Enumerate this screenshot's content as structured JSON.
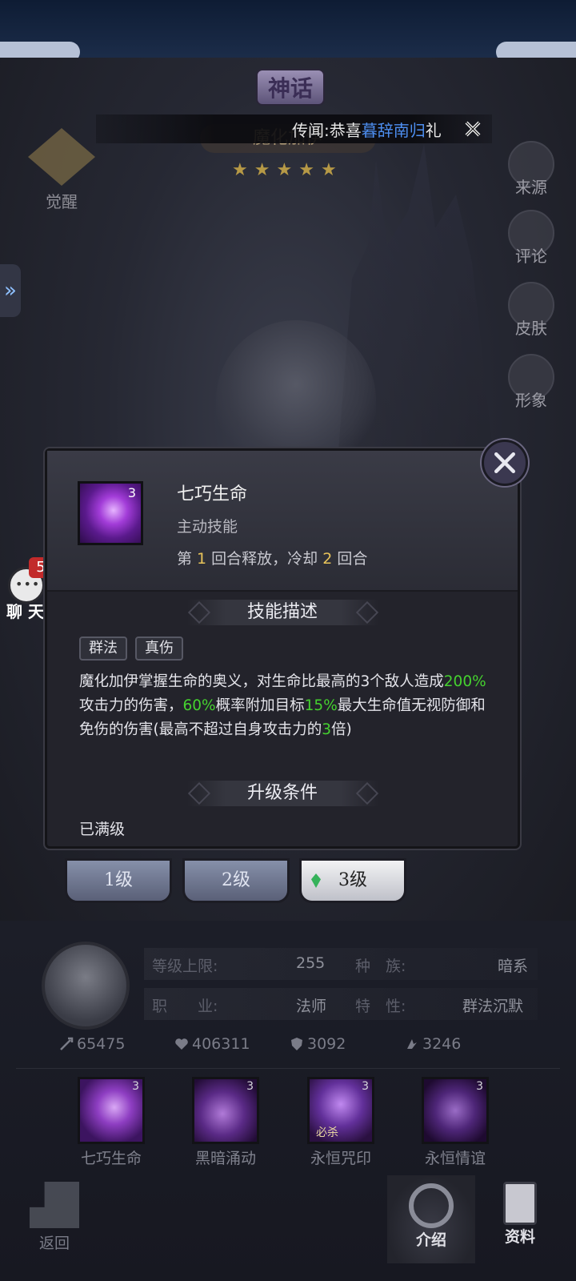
{
  "news": {
    "label": "传闻:",
    "body": "恭喜",
    "name": "暮辞南归",
    "tail": "礼"
  },
  "hero": {
    "rank": "神话",
    "name": "魔化加伊",
    "stars": [
      "★",
      "★",
      "★",
      "★",
      "★"
    ]
  },
  "awaken": {
    "label": "觉醒"
  },
  "side_buttons": [
    {
      "label": "来源"
    },
    {
      "label": "评论"
    },
    {
      "label": "皮肤"
    },
    {
      "label": "形象"
    }
  ],
  "left_tab": {
    "glyph": "»"
  },
  "chat": {
    "badge": "5",
    "label": "聊 天"
  },
  "skill_popup": {
    "level_badge": "3",
    "name": "七巧生命",
    "type": "主动技能",
    "cd_prefix": "第 ",
    "cd_round": "1",
    "cd_mid": " 回合释放，冷却 ",
    "cd_value": "2",
    "cd_suffix": " 回合",
    "desc_title": "技能描述",
    "tags": [
      "群法",
      "真伤"
    ],
    "desc": {
      "p1": "魔化加伊掌握生命的奥义，对生命比最高的3个敌人造成",
      "g1": "200%",
      "p2": "攻击力的伤害，",
      "g2": "60%",
      "p3": "概率附加目标",
      "g3": "15%",
      "p4": "最大生命值无视防御和免伤的伤害(最高不超过自身攻击力的",
      "g4": "3",
      "p5": "倍)"
    },
    "upgrade_title": "升级条件",
    "upgrade_status": "已满级"
  },
  "level_tabs": [
    {
      "label": "1级",
      "active": false
    },
    {
      "label": "2级",
      "active": false
    },
    {
      "label": "3级",
      "active": true
    }
  ],
  "info": {
    "level_cap_key": "等级上限:",
    "level_cap_val": "255",
    "race_key": "种　族:",
    "race_val": "暗系",
    "class_key": "职　　业:",
    "class_val": "法师",
    "trait_key": "特　性:",
    "trait_val": "群法沉默"
  },
  "stats": [
    {
      "icon": "attack-icon",
      "value": "65475"
    },
    {
      "icon": "heart-icon",
      "value": "406311"
    },
    {
      "icon": "shield-icon",
      "value": "3092"
    },
    {
      "icon": "speed-icon",
      "value": "3246"
    }
  ],
  "skills": [
    {
      "name": "七巧生命",
      "level": "3",
      "tag": ""
    },
    {
      "name": "黑暗涌动",
      "level": "3",
      "tag": ""
    },
    {
      "name": "永恒咒印",
      "level": "3",
      "tag": "必杀"
    },
    {
      "name": "永恒情谊",
      "level": "3",
      "tag": ""
    }
  ],
  "nav": {
    "back": "返回",
    "intro": "介绍",
    "data": "资料"
  },
  "colors": {
    "highlight_green": "#45d12f",
    "highlight_gold": "#e8c35a",
    "news_name": "#4d8ef0"
  }
}
